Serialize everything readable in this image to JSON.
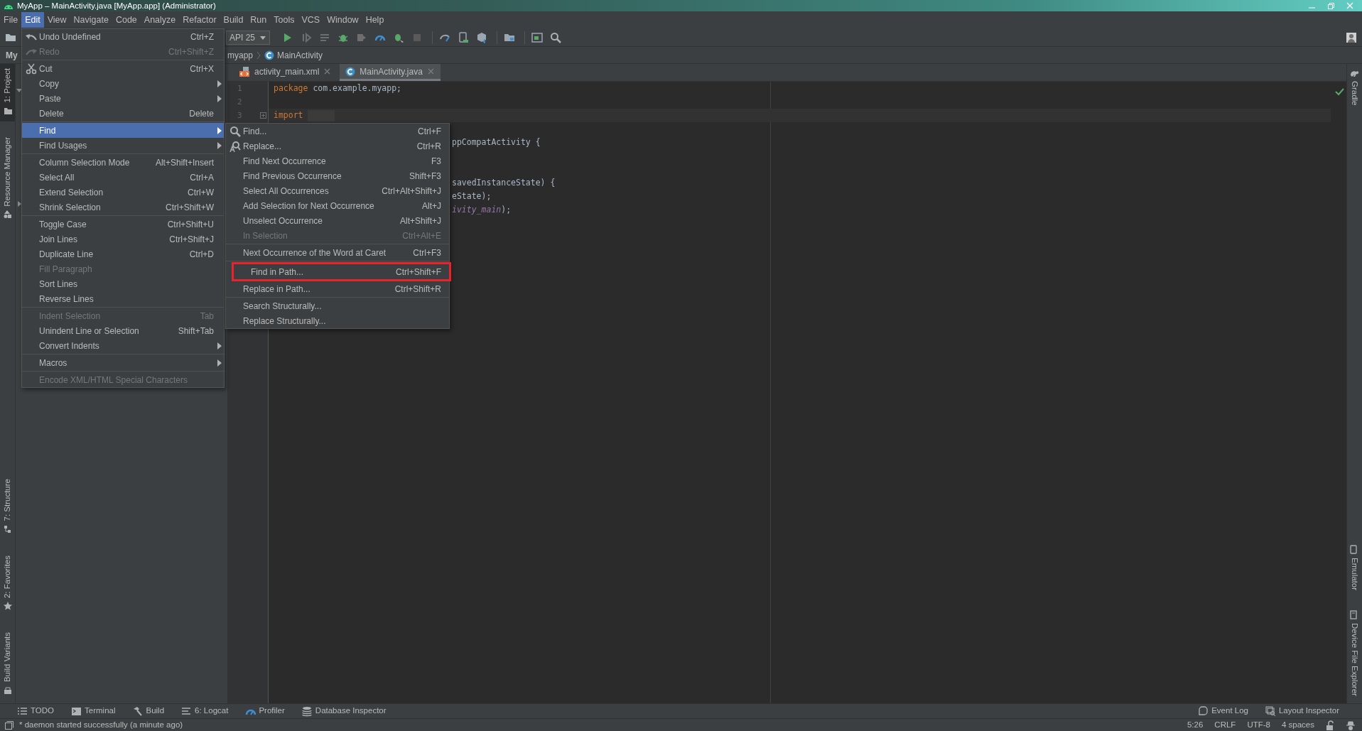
{
  "window": {
    "title": "MyApp – MainActivity.java [MyApp.app] (Administrator)"
  },
  "menu_bar": [
    {
      "label": "File",
      "selected": false
    },
    {
      "label": "Edit",
      "selected": true
    },
    {
      "label": "View",
      "selected": false
    },
    {
      "label": "Navigate",
      "selected": false
    },
    {
      "label": "Code",
      "selected": false
    },
    {
      "label": "Analyze",
      "selected": false
    },
    {
      "label": "Refactor",
      "selected": false
    },
    {
      "label": "Build",
      "selected": false
    },
    {
      "label": "Run",
      "selected": false
    },
    {
      "label": "Tools",
      "selected": false
    },
    {
      "label": "VCS",
      "selected": false
    },
    {
      "label": "Window",
      "selected": false
    },
    {
      "label": "Help",
      "selected": false
    }
  ],
  "toolbar": {
    "run_configuration": "API 25"
  },
  "navigation_bar": {
    "project": "My",
    "crumbs": [
      "myapp",
      "MainActivity"
    ]
  },
  "left_tool_windows": {
    "top": [
      {
        "label": "1: Project",
        "selected": true
      },
      {
        "label": "Resource Manager",
        "selected": false
      }
    ],
    "bottom": [
      {
        "label": "7: Structure",
        "selected": false
      },
      {
        "label": "2: Favorites",
        "selected": false
      },
      {
        "label": "Build Variants",
        "selected": false
      }
    ]
  },
  "right_tool_windows": {
    "top": [
      {
        "label": "Gradle",
        "selected": false
      }
    ],
    "bottom": [
      {
        "label": "Emulator",
        "selected": false
      },
      {
        "label": "Device File Explorer",
        "selected": false
      }
    ]
  },
  "editor_tabs": [
    {
      "label": "activity_main.xml",
      "kind": "xml",
      "selected": false
    },
    {
      "label": "MainActivity.java",
      "kind": "class",
      "selected": true
    }
  ],
  "editor": {
    "lines": [
      {
        "number": "1",
        "current": false,
        "tokens": [
          {
            "kind": "keyword",
            "text": "package"
          },
          {
            "kind": "plain",
            "text": " com.example.myapp;"
          }
        ]
      },
      {
        "number": "2",
        "current": false
      },
      {
        "number": "3",
        "current": true,
        "folded": true,
        "tokens": [
          {
            "kind": "keyword",
            "text": "import"
          }
        ]
      }
    ],
    "partly_hidden_lines": [
      {
        "tokens": [
          {
            "kind": "plain",
            "text": "ppCompatActivity {"
          }
        ]
      },
      {
        "tokens": [
          {
            "kind": "plain",
            "text": "savedInstanceState) {"
          }
        ]
      },
      {
        "tokens": [
          {
            "kind": "plain",
            "text": "eState);"
          }
        ]
      },
      {
        "tokens": [
          {
            "kind": "field",
            "text": "ivity_main"
          },
          {
            "kind": "plain",
            "text": ");"
          }
        ]
      }
    ]
  },
  "edit_menu": [
    {
      "kind": "item",
      "label": "Undo Undefined",
      "shortcut": "Ctrl+Z",
      "disabled": false,
      "submenu": false,
      "selected": false
    },
    {
      "kind": "item",
      "label": "Redo",
      "shortcut": "Ctrl+Shift+Z",
      "disabled": true,
      "submenu": false,
      "selected": false
    },
    {
      "kind": "separator"
    },
    {
      "kind": "item",
      "label": "Cut",
      "shortcut": "Ctrl+X",
      "disabled": false,
      "submenu": false,
      "selected": false
    },
    {
      "kind": "item",
      "label": "Copy",
      "disabled": false,
      "submenu": true,
      "selected": false
    },
    {
      "kind": "item",
      "label": "Paste",
      "disabled": false,
      "submenu": true,
      "selected": false
    },
    {
      "kind": "item",
      "label": "Delete",
      "shortcut": "Delete",
      "disabled": false,
      "submenu": false,
      "selected": false
    },
    {
      "kind": "separator"
    },
    {
      "kind": "item",
      "label": "Find",
      "disabled": false,
      "submenu": true,
      "selected": true
    },
    {
      "kind": "item",
      "label": "Find Usages",
      "disabled": false,
      "submenu": true,
      "selected": false
    },
    {
      "kind": "separator"
    },
    {
      "kind": "item",
      "label": "Column Selection Mode",
      "shortcut": "Alt+Shift+Insert",
      "disabled": false,
      "submenu": false,
      "selected": false
    },
    {
      "kind": "item",
      "label": "Select All",
      "shortcut": "Ctrl+A",
      "disabled": false,
      "submenu": false,
      "selected": false
    },
    {
      "kind": "item",
      "label": "Extend Selection",
      "shortcut": "Ctrl+W",
      "disabled": false,
      "submenu": false,
      "selected": false
    },
    {
      "kind": "item",
      "label": "Shrink Selection",
      "shortcut": "Ctrl+Shift+W",
      "disabled": false,
      "submenu": false,
      "selected": false
    },
    {
      "kind": "separator"
    },
    {
      "kind": "item",
      "label": "Toggle Case",
      "shortcut": "Ctrl+Shift+U",
      "disabled": false,
      "submenu": false,
      "selected": false
    },
    {
      "kind": "item",
      "label": "Join Lines",
      "shortcut": "Ctrl+Shift+J",
      "disabled": false,
      "submenu": false,
      "selected": false
    },
    {
      "kind": "item",
      "label": "Duplicate Line",
      "shortcut": "Ctrl+D",
      "disabled": false,
      "submenu": false,
      "selected": false
    },
    {
      "kind": "item",
      "label": "Fill Paragraph",
      "disabled": true,
      "submenu": false,
      "selected": false
    },
    {
      "kind": "item",
      "label": "Sort Lines",
      "disabled": false,
      "submenu": false,
      "selected": false
    },
    {
      "kind": "item",
      "label": "Reverse Lines",
      "disabled": false,
      "submenu": false,
      "selected": false
    },
    {
      "kind": "separator"
    },
    {
      "kind": "item",
      "label": "Indent Selection",
      "shortcut": "Tab",
      "disabled": true,
      "submenu": false,
      "selected": false
    },
    {
      "kind": "item",
      "label": "Unindent Line or Selection",
      "shortcut": "Shift+Tab",
      "disabled": false,
      "submenu": false,
      "selected": false
    },
    {
      "kind": "item",
      "label": "Convert Indents",
      "disabled": false,
      "submenu": true,
      "selected": false
    },
    {
      "kind": "separator"
    },
    {
      "kind": "item",
      "label": "Macros",
      "disabled": false,
      "submenu": true,
      "selected": false
    },
    {
      "kind": "separator"
    },
    {
      "kind": "item",
      "label": "Encode XML/HTML Special Characters",
      "disabled": true,
      "submenu": false,
      "selected": false
    }
  ],
  "find_submenu": [
    {
      "kind": "item",
      "label": "Find...",
      "shortcut": "Ctrl+F",
      "disabled": false,
      "highlighted": false
    },
    {
      "kind": "item",
      "label": "Replace...",
      "shortcut": "Ctrl+R",
      "disabled": false,
      "highlighted": false
    },
    {
      "kind": "item",
      "label": "Find Next Occurrence",
      "shortcut": "F3",
      "disabled": false,
      "highlighted": false
    },
    {
      "kind": "item",
      "label": "Find Previous Occurrence",
      "shortcut": "Shift+F3",
      "disabled": false,
      "highlighted": false
    },
    {
      "kind": "item",
      "label": "Select All Occurrences",
      "shortcut": "Ctrl+Alt+Shift+J",
      "disabled": false,
      "highlighted": false
    },
    {
      "kind": "item",
      "label": "Add Selection for Next Occurrence",
      "shortcut": "Alt+J",
      "disabled": false,
      "highlighted": false
    },
    {
      "kind": "item",
      "label": "Unselect Occurrence",
      "shortcut": "Alt+Shift+J",
      "disabled": false,
      "highlighted": false
    },
    {
      "kind": "item",
      "label": "In Selection",
      "shortcut": "Ctrl+Alt+E",
      "disabled": true,
      "highlighted": false
    },
    {
      "kind": "separator"
    },
    {
      "kind": "item",
      "label": "Next Occurrence of the Word at Caret",
      "shortcut": "Ctrl+F3",
      "disabled": false,
      "highlighted": false
    },
    {
      "kind": "separator"
    },
    {
      "kind": "item",
      "label": "Find in Path...",
      "shortcut": "Ctrl+Shift+F",
      "disabled": false,
      "highlighted": true
    },
    {
      "kind": "item",
      "label": "Replace in Path...",
      "shortcut": "Ctrl+Shift+R",
      "disabled": false,
      "highlighted": false
    },
    {
      "kind": "separator"
    },
    {
      "kind": "item",
      "label": "Search Structurally...",
      "disabled": false,
      "highlighted": false
    },
    {
      "kind": "item",
      "label": "Replace Structurally...",
      "disabled": false,
      "highlighted": false
    }
  ],
  "tool_window_bar": {
    "left": [
      "TODO",
      "Terminal",
      "Build",
      "6: Logcat",
      "Profiler",
      "Database Inspector"
    ],
    "right": [
      "Event Log",
      "Layout Inspector"
    ]
  },
  "status_bar": {
    "message": "* daemon started successfully (a minute ago)",
    "items": [
      "5:26",
      "CRLF",
      "UTF-8",
      "4 spaces"
    ]
  }
}
